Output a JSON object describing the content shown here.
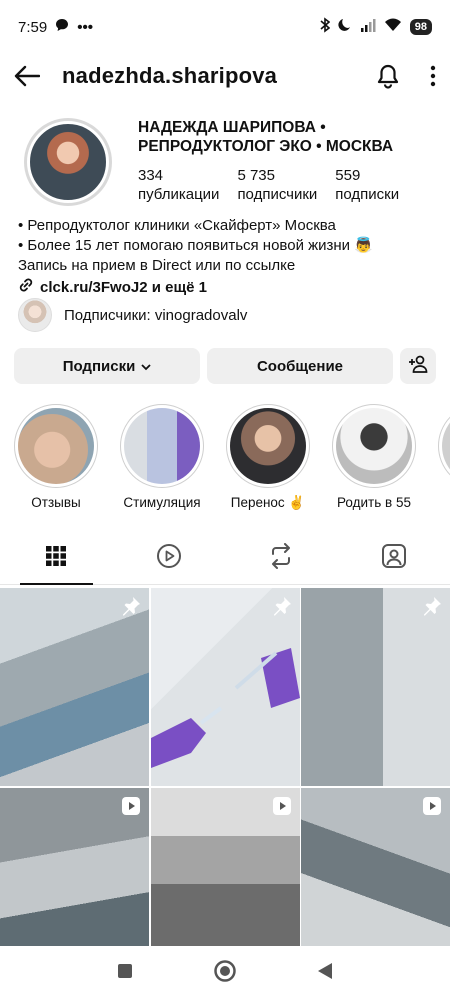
{
  "status": {
    "time": "7:59",
    "battery": "98"
  },
  "header": {
    "username": "nadezhda.sharipova"
  },
  "profile": {
    "name": "НАДЕЖДА ШАРИПОВА • РЕПРОДУКТОЛОГ ЭКО • МОСКВА",
    "stats": [
      {
        "value": "334",
        "label": "публикации"
      },
      {
        "value": "5 735",
        "label": "подписчики"
      },
      {
        "value": "559",
        "label": "подписки"
      }
    ]
  },
  "bio": {
    "line1": "• Репродуктолог клиники «Скайферт» Москва",
    "line2": "• Более 15 лет помогаю появиться новой жизни 👼",
    "line3": "Запись на прием в Direct или по ссылке",
    "link": "clck.ru/3FwoJ2 и ещё 1"
  },
  "followers": {
    "text": "Подписчики: vinogradovalv"
  },
  "actions": {
    "subscriptions": "Подписки",
    "message": "Сообщение"
  },
  "highlights": [
    {
      "label": "Отзывы",
      "color": "#c9a98f"
    },
    {
      "label": "Стимуляция",
      "color": "#b9c3e0"
    },
    {
      "label": "Перенос ✌️",
      "color": "#8a6a5a"
    },
    {
      "label": "Родить в 55",
      "color": "#d7d7d7"
    }
  ],
  "colors": {
    "accent": "#111111",
    "button_bg": "#efefef"
  }
}
